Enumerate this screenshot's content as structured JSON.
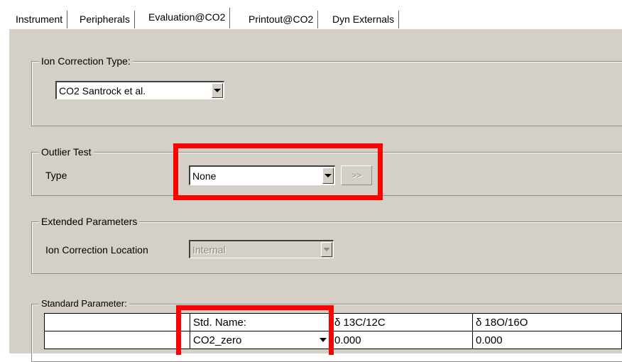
{
  "tabs": [
    {
      "label": "Instrument",
      "active": false
    },
    {
      "label": "Peripherals",
      "active": false
    },
    {
      "label": "Evaluation@CO2",
      "active": true
    },
    {
      "label": "Printout@CO2",
      "active": false
    },
    {
      "label": "Dyn Externals",
      "active": false
    }
  ],
  "ion_correction_type": {
    "legend": "Ion Correction Type:",
    "selected": "CO2 Santrock et al."
  },
  "outlier_test": {
    "legend": "Outlier Test",
    "type_label": "Type",
    "selected": "None",
    "more_button": ">>"
  },
  "extended_parameters": {
    "legend": "Extended Parameters",
    "location_label": "Ion Correction Location",
    "location_value": "Internal"
  },
  "standard_parameter": {
    "legend": "Standard Parameter:",
    "headers": [
      "",
      "Std. Name:",
      "δ 13C/12C",
      "δ 18O/16O"
    ],
    "rows": [
      {
        "name": "CO2_zero",
        "d13c": "0.000",
        "d18o": "0.000"
      }
    ]
  },
  "colors": {
    "highlight": "#ff0000",
    "panel": "#d4d0c8"
  }
}
